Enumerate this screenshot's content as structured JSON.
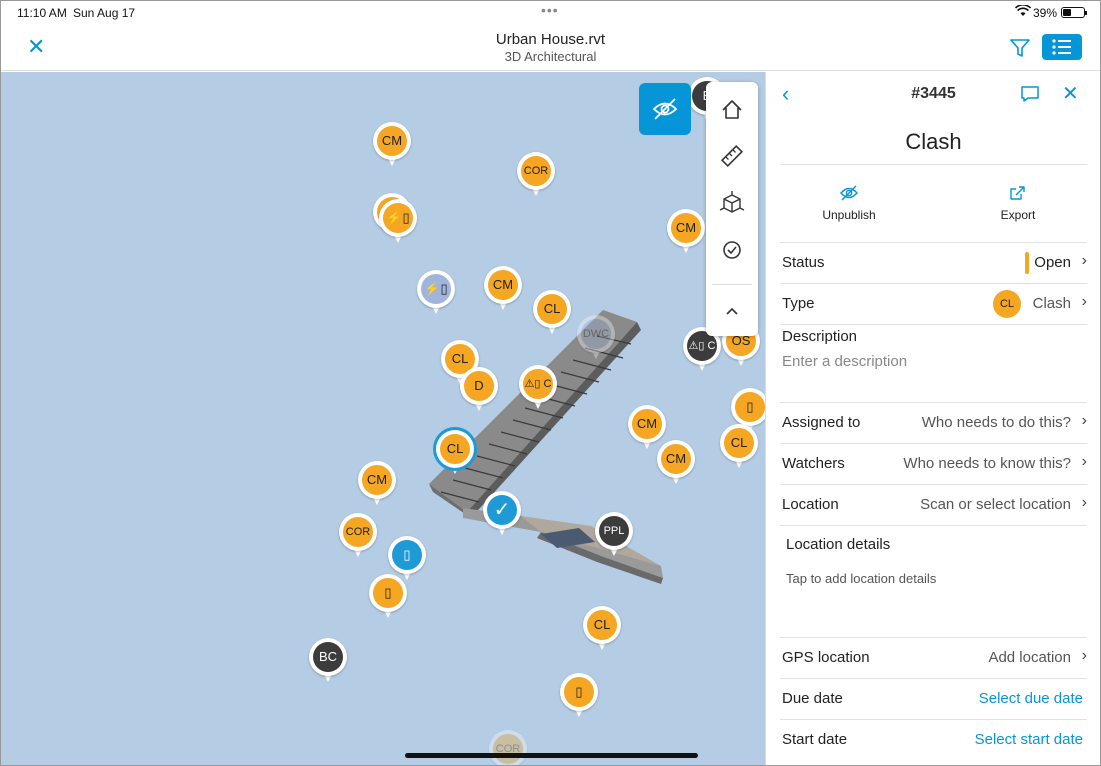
{
  "status_bar": {
    "time": "11:10 AM",
    "date": "Sun Aug 17",
    "battery": "39%"
  },
  "nav": {
    "title": "Urban House.rvt",
    "subtitle": "3D Architectural"
  },
  "pins": [
    {
      "label": "CM",
      "style": "orange",
      "faded": false
    },
    {
      "label": "COR",
      "style": "orange",
      "faded": false
    },
    {
      "label": "CM",
      "style": "orange",
      "faded": false
    },
    {
      "label": "⚡▯",
      "style": "orange",
      "faded": false
    },
    {
      "label": "⚡▯",
      "style": "light",
      "faded": false
    },
    {
      "label": "CM",
      "style": "orange",
      "faded": false
    },
    {
      "label": "CL",
      "style": "orange",
      "faded": false
    },
    {
      "label": "CL",
      "style": "orange",
      "faded": false
    },
    {
      "label": "D",
      "style": "orange",
      "faded": false
    },
    {
      "label": "⚠▯ C",
      "style": "orange",
      "faded": false
    },
    {
      "label": "CL",
      "style": "orange",
      "faded": false
    },
    {
      "label": "CM",
      "style": "orange",
      "faded": false
    },
    {
      "label": "CM",
      "style": "orange",
      "faded": false
    },
    {
      "label": "CM",
      "style": "orange",
      "faded": false
    },
    {
      "label": "COR",
      "style": "orange",
      "faded": false
    },
    {
      "label": "▯",
      "style": "blue",
      "faded": false
    },
    {
      "label": "▯",
      "style": "orange",
      "faded": false
    },
    {
      "label": "✓",
      "style": "check",
      "faded": false
    },
    {
      "label": "PPL",
      "style": "dark",
      "faded": false
    },
    {
      "label": "CL",
      "style": "orange",
      "faded": false
    },
    {
      "label": "BC",
      "style": "dark",
      "faded": false
    },
    {
      "label": "▯",
      "style": "orange",
      "faded": false
    },
    {
      "label": "COR",
      "style": "orange",
      "faded": true
    },
    {
      "label": "CM",
      "style": "orange",
      "faded": false
    },
    {
      "label": "⚠▯ C",
      "style": "dark",
      "faded": false
    },
    {
      "label": "OS",
      "style": "orange",
      "faded": false
    },
    {
      "label": "▯",
      "style": "orange",
      "faded": false
    },
    {
      "label": "CL",
      "style": "orange",
      "faded": false
    },
    {
      "label": "DWC",
      "style": "light",
      "faded": true
    },
    {
      "label": "B",
      "style": "dark",
      "faded": false
    }
  ],
  "panel": {
    "issue_number": "#3445",
    "title": "Clash",
    "actions": {
      "unpublish": "Unpublish",
      "export": "Export"
    },
    "status": {
      "label": "Status",
      "value": "Open",
      "color": "#f5a623"
    },
    "type": {
      "label": "Type",
      "badge": "CL",
      "value": "Clash"
    },
    "description": {
      "label": "Description",
      "placeholder": "Enter a description"
    },
    "assigned_to": {
      "label": "Assigned to",
      "value": "Who needs to do this?"
    },
    "watchers": {
      "label": "Watchers",
      "value": "Who needs to know this?"
    },
    "location": {
      "label": "Location",
      "value": "Scan or select location"
    },
    "location_details": {
      "label": "Location details",
      "hint": "Tap to add location details"
    },
    "gps_location": {
      "label": "GPS location",
      "value": "Add location"
    },
    "due_date": {
      "label": "Due date",
      "value": "Select due date"
    },
    "start_date": {
      "label": "Start date",
      "value": "Select start date"
    }
  },
  "colors": {
    "accent": "#0696d7",
    "pin_orange": "#f5a623",
    "pin_dark": "#3c3c3c",
    "viewport_bg": "#b4cce4"
  },
  "icons": [
    "close-icon",
    "filter-icon",
    "list-icon",
    "eye-off-icon",
    "home-icon",
    "ruler-icon",
    "section-box-icon",
    "check-circle-icon",
    "chevron-up-icon",
    "back-chevron-icon",
    "comment-icon",
    "unpublish-icon",
    "export-icon"
  ]
}
